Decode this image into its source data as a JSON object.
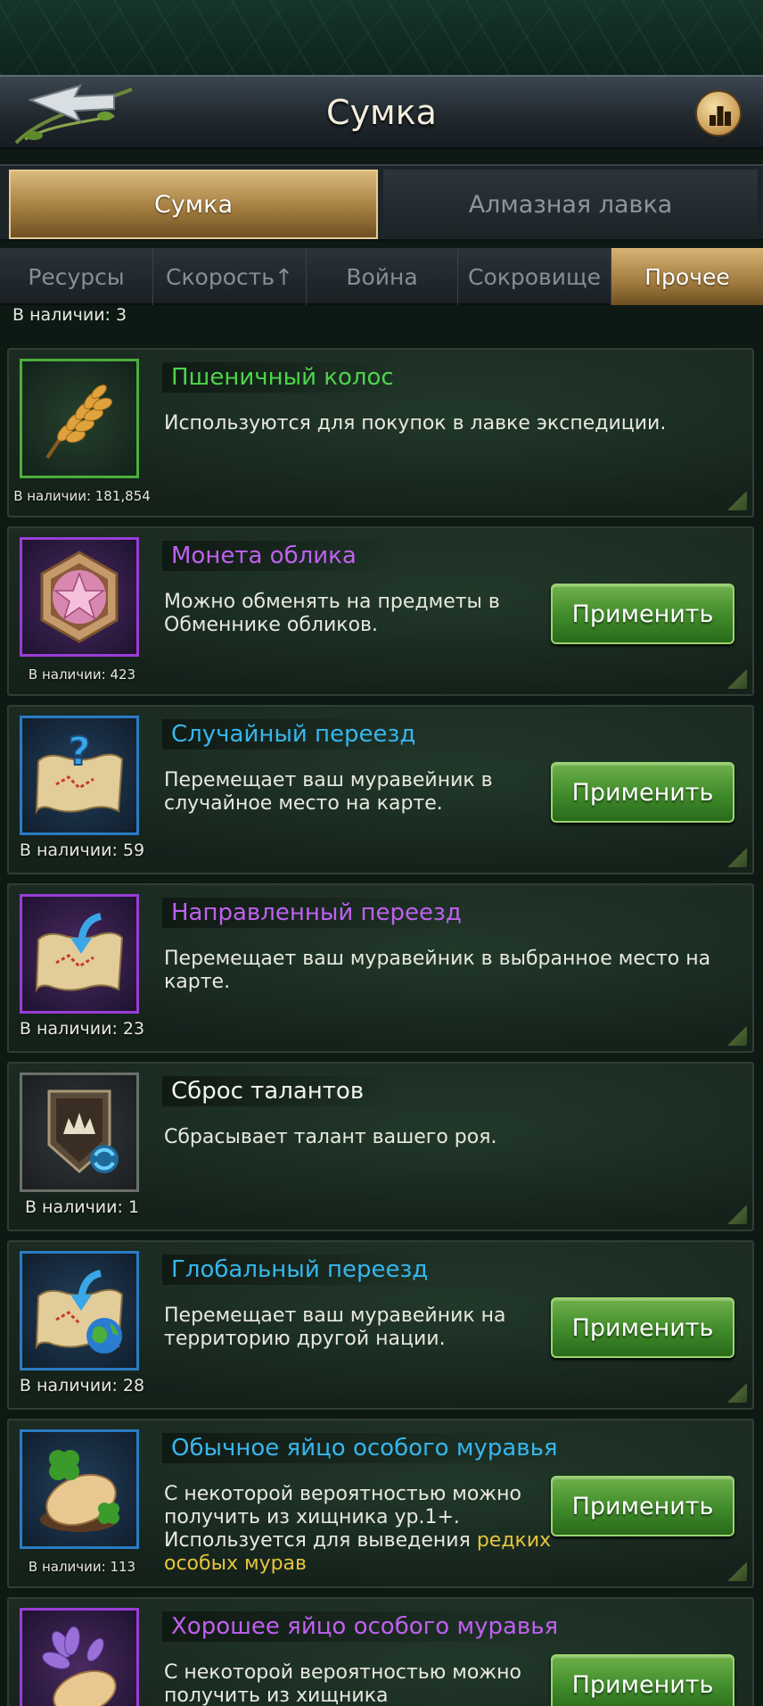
{
  "header": {
    "title": "Сумка",
    "back_icon": "back-arrow-icon",
    "rank_icon": "ranking-chart-icon"
  },
  "main_tabs": [
    {
      "label": "Сумка",
      "active": true
    },
    {
      "label": "Алмазная лавка",
      "active": false
    }
  ],
  "sub_tabs": [
    {
      "label": "Ресурсы",
      "active": false
    },
    {
      "label": "Скорость↑",
      "active": false
    },
    {
      "label": "Война",
      "active": false
    },
    {
      "label": "Сокровище",
      "active": false
    },
    {
      "label": "Прочее",
      "active": true
    }
  ],
  "partial_count": "В наличии: 3",
  "apply_label": "Применить",
  "colors": {
    "green": "#4ed44a",
    "purple": "#c060f0",
    "blue": "#37b6ec",
    "highlight": "#e6c43c"
  },
  "items": [
    {
      "name": "Пшеничный колос",
      "desc": "Используются для покупок в лавке экспедиции.",
      "count": "В наличии: 181,854",
      "icon": "wheat-icon",
      "rarity": "green",
      "has_apply": false
    },
    {
      "name": "Монета облика",
      "desc": "Можно обменять на предметы в Обменнике обликов.",
      "count": "В наличии: 423",
      "icon": "skin-coin-icon",
      "rarity": "purple",
      "has_apply": true
    },
    {
      "name": "Случайный переезд",
      "desc": "Перемещает ваш муравейник в случайное место на карте.",
      "count": "В наличии: 59",
      "icon": "random-relocation-map-icon",
      "rarity": "blue",
      "has_apply": true
    },
    {
      "name": "Направленный переезд",
      "desc": "Перемещает ваш муравейник в выбранное место на карте.",
      "count": "В наличии: 23",
      "icon": "targeted-relocation-map-icon",
      "rarity": "purple",
      "has_apply": false
    },
    {
      "name": "Сброс талантов",
      "desc": "Сбрасывает талант вашего роя.",
      "count": "В наличии: 1",
      "icon": "talent-reset-shield-icon",
      "rarity": "white",
      "has_apply": false
    },
    {
      "name": "Глобальный переезд",
      "desc": "Перемещает ваш муравейник на территорию другой нации.",
      "count": "В наличии: 28",
      "icon": "global-relocation-map-icon",
      "rarity": "blue",
      "has_apply": true
    },
    {
      "name": "Обычное яйцо особого муравья",
      "desc_main": "С некоторой вероятностью можно получить из хищника ур.1+. Используется для выведения",
      "desc_highlight": "редких особых мурав",
      "count": "В наличии: 113",
      "icon": "clover-egg-icon",
      "rarity": "blue",
      "has_apply": true
    },
    {
      "name": "Хорошее яйцо особого муравья",
      "desc": "С некоторой вероятностью можно получить из хищника",
      "icon": "flower-egg-icon",
      "rarity": "purple",
      "has_apply": true
    }
  ]
}
